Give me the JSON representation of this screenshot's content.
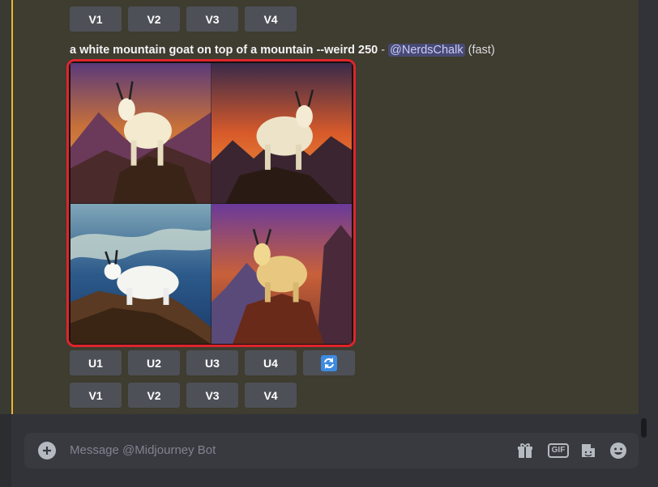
{
  "top_variation_buttons": [
    "V1",
    "V2",
    "V3",
    "V4"
  ],
  "message": {
    "prompt": "a white mountain goat on top of a mountain --weird 250",
    "separator": " - ",
    "mention": "@NerdsChalk",
    "speed": "(fast)"
  },
  "image_grid": {
    "highlight_color": "#e0242b",
    "tiles": [
      "mountain-goat-image-1",
      "mountain-goat-image-2",
      "mountain-goat-image-3",
      "mountain-goat-image-4"
    ]
  },
  "upscale_buttons": [
    "U1",
    "U2",
    "U3",
    "U4"
  ],
  "reroll_icon": "reroll-icon",
  "variation_buttons": [
    "V1",
    "V2",
    "V3",
    "V4"
  ],
  "composer": {
    "placeholder": "Message @Midjourney Bot",
    "icons": [
      "plus-circle-icon",
      "gift-icon",
      "gif-icon",
      "sticker-icon",
      "emoji-icon"
    ]
  },
  "colors": {
    "accent_bar": "#f0b232",
    "button_bg": "#4e5058",
    "reroll_bg": "#5865f2",
    "mention_text": "#c9cdfb"
  }
}
